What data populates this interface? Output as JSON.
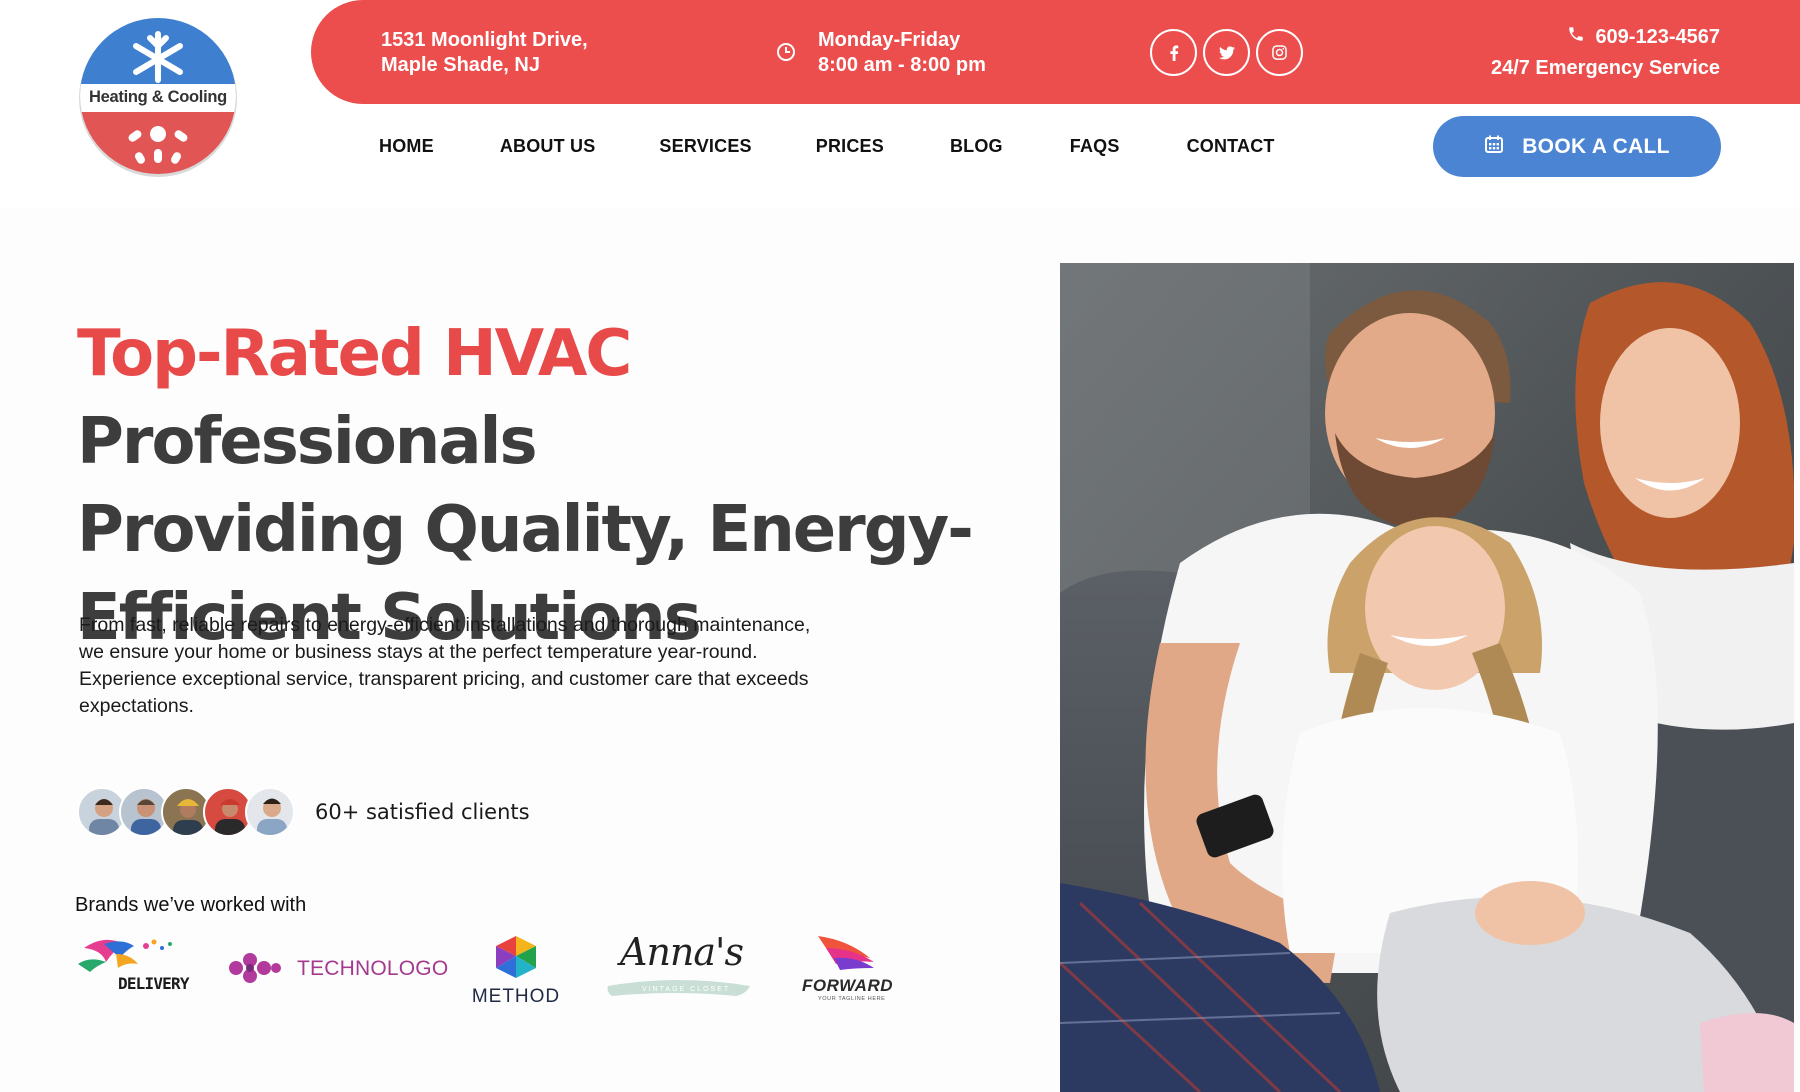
{
  "logo": {
    "text": "Heating & Cooling"
  },
  "topbar": {
    "address_line1": "1531 Moonlight Drive,",
    "address_line2": "Maple Shade, NJ",
    "hours_line1": "Monday-Friday",
    "hours_line2": "8:00 am - 8:00 pm",
    "social": [
      {
        "icon": "facebook-icon",
        "glyph": "f"
      },
      {
        "icon": "twitter-icon",
        "glyph": "t"
      },
      {
        "icon": "instagram-icon",
        "glyph": "◎"
      }
    ],
    "phone": "609-123-4567",
    "emergency": "24/7 Emergency Service",
    "color": "#ec4d4d"
  },
  "nav": {
    "items": [
      "HOME",
      "ABOUT US",
      "SERVICES",
      "PRICES",
      "BLOG",
      "FAQS",
      "CONTACT"
    ],
    "book_label": "BOOK A CALL",
    "book_color": "#4a84d3"
  },
  "hero": {
    "headline_accent": "Top-Rated HVAC",
    "headline_rest1": " Professionals",
    "headline_rest2": "Providing Quality, Energy-",
    "headline_rest3": "Efficient Solutions",
    "description_line1": "From fast, reliable repairs to energy-efficient installations and thorough maintenance,",
    "description_line2": "we ensure your home or business stays at the perfect temperature year-round.",
    "description_line3": "Experience exceptional service, transparent pricing, and customer care that exceeds",
    "description_line4": "expectations.",
    "clients_text": "60+ satisfied clients",
    "brands_title": "Brands we’ve worked with",
    "brands": [
      "DELIVERY",
      "TECHNOLOGO",
      "METHOD",
      "Anna's",
      "FORWARD"
    ],
    "brand_subtexts": [
      "VINTAGE CLOSET",
      "YOUR TAGLINE HERE"
    ]
  }
}
